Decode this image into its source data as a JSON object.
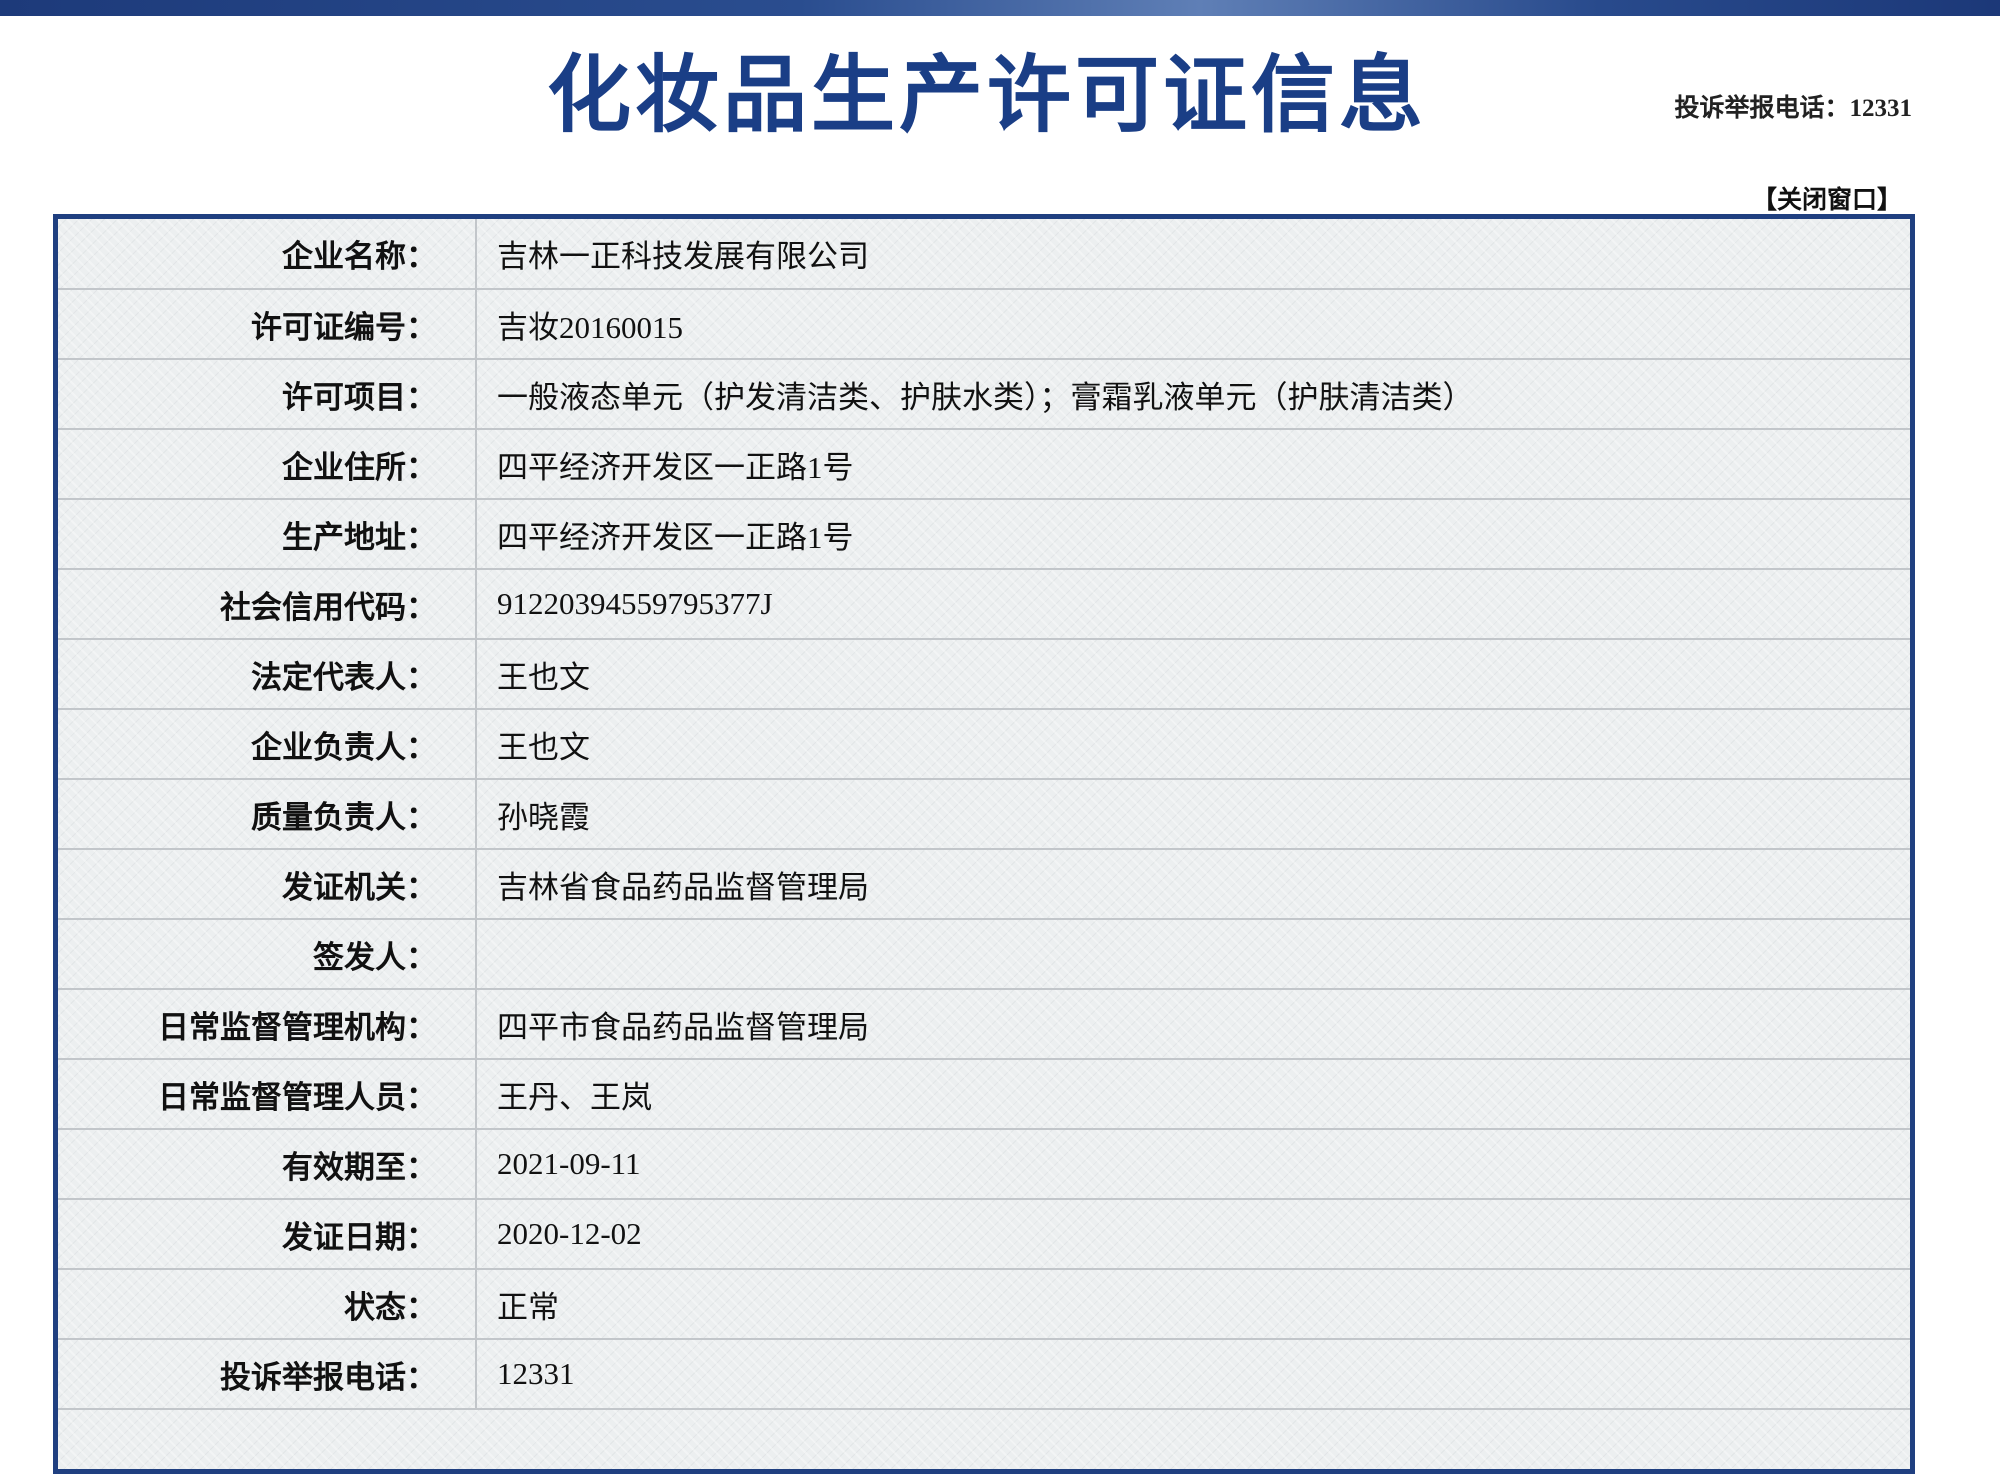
{
  "page": {
    "title": "化妆品生产许可证信息",
    "hotline": "投诉举报电话：12331",
    "close_label": "【关闭窗口】"
  },
  "rows": [
    {
      "label": "企业名称：",
      "value": "吉林一正科技发展有限公司"
    },
    {
      "label": "许可证编号：",
      "value": "吉妆20160015"
    },
    {
      "label": "许可项目：",
      "value": "一般液态单元（护发清洁类、护肤水类）；膏霜乳液单元（护肤清洁类）"
    },
    {
      "label": "企业住所：",
      "value": "四平经济开发区一正路1号"
    },
    {
      "label": "生产地址：",
      "value": "四平经济开发区一正路1号"
    },
    {
      "label": "社会信用代码：",
      "value": "91220394559795377J"
    },
    {
      "label": "法定代表人：",
      "value": "王也文"
    },
    {
      "label": "企业负责人：",
      "value": "王也文"
    },
    {
      "label": "质量负责人：",
      "value": "孙晓霞"
    },
    {
      "label": "发证机关：",
      "value": "吉林省食品药品监督管理局"
    },
    {
      "label": "签发人：",
      "value": ""
    },
    {
      "label": "日常监督管理机构：",
      "value": "四平市食品药品监督管理局"
    },
    {
      "label": "日常监督管理人员：",
      "value": "王丹、王岚"
    },
    {
      "label": "有效期至：",
      "value": "2021-09-11"
    },
    {
      "label": "发证日期：",
      "value": "2020-12-02"
    },
    {
      "label": "状态：",
      "value": "正常"
    },
    {
      "label": "投诉举报电话：",
      "value": "12331"
    }
  ],
  "colors": {
    "title": "#1a3e86",
    "table_border": "#1f3f80",
    "table_bg": "#eceff0"
  }
}
